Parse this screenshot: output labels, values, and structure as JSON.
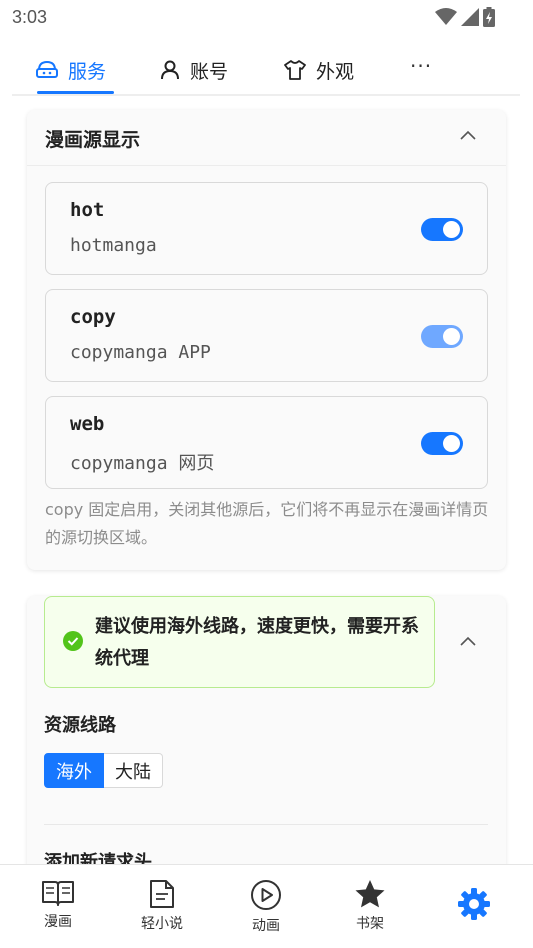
{
  "status": {
    "time": "3:03",
    "icons": [
      "wifi-icon",
      "signal-icon",
      "battery-charging-icon"
    ]
  },
  "tabs": [
    {
      "label": "服务",
      "icon": "service-icon",
      "active": true
    },
    {
      "label": "账号",
      "icon": "user-icon"
    },
    {
      "label": "外观",
      "icon": "shirt-icon"
    }
  ],
  "tabs_more": "···",
  "accent": "#1677ff",
  "sources_card": {
    "title": "漫画源显示",
    "items": [
      {
        "name": "hot",
        "desc": "hotmanga",
        "enabled": true
      },
      {
        "name": "copy",
        "desc": "copymanga APP",
        "enabled": true,
        "disabled": true
      },
      {
        "name": "web",
        "desc": "copymanga 网页",
        "enabled": true
      }
    ],
    "note": "copy 固定启用，关闭其他源后，它们将不再显示在漫画详情页的源切换区域。"
  },
  "network_card": {
    "alert": "建议使用海外线路，速度更快，需要开系统代理",
    "route_label": "资源线路",
    "routes": [
      "海外",
      "大陆"
    ],
    "selected_route": "海外",
    "add_header_label": "添加新请求头"
  },
  "bottom_nav": [
    {
      "label": "漫画",
      "icon": "book-icon"
    },
    {
      "label": "轻小说",
      "icon": "document-icon"
    },
    {
      "label": "动画",
      "icon": "play-icon"
    },
    {
      "label": "书架",
      "icon": "star-icon"
    },
    {
      "label": "",
      "icon": "gear-icon",
      "active": true
    }
  ]
}
